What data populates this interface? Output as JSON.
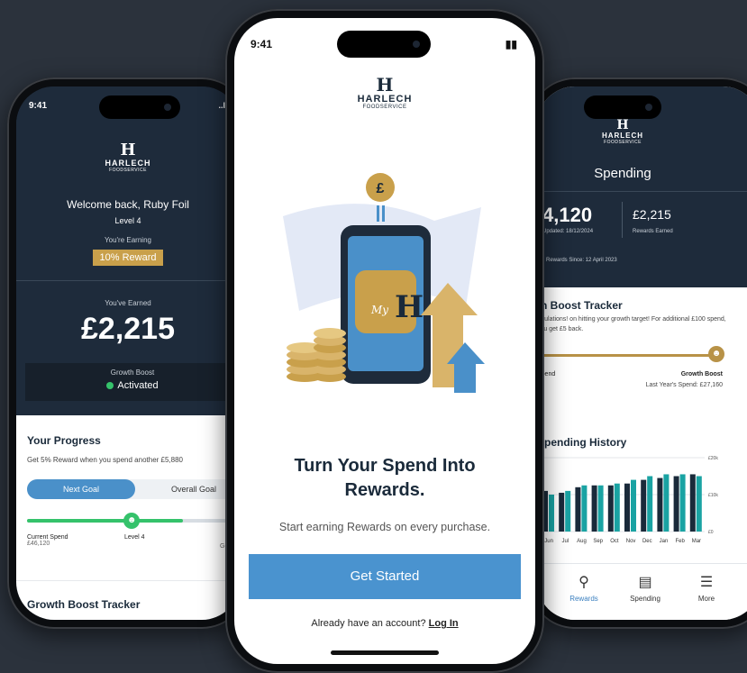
{
  "brand": {
    "initial": "H",
    "name": "HARLECH",
    "tagline": "FOODSERVICE"
  },
  "left_phone": {
    "time": "9:41",
    "signal": "..l",
    "welcome": "Welcome back, Ruby Foil",
    "level": "Level 4",
    "earning_label": "You're Earning",
    "reward_badge": "10% Reward",
    "earned_label": "You've Earned",
    "earned_amount": "£2,215",
    "growth_boost_label": "Growth Boost",
    "growth_boost_status": "Activated",
    "progress_title": "Your Progress",
    "progress_desc": "Get 5% Reward when you spend another £5,880",
    "tab_next": "Next Goal",
    "tab_overall": "Overall Goal",
    "progress_fraction": 0.72,
    "current_spend_label": "Current Spend",
    "current_spend_value": "£46,120",
    "level_marker": "Level 4",
    "goal_label": "Goa",
    "next_section": "Growth Boost Tracker"
  },
  "center_phone": {
    "time": "9:41",
    "headline": "Turn Your Spend Into Rewards.",
    "subtext": "Start earning Rewards on every purchase.",
    "cta": "Get Started",
    "login_prompt": "Already have an account?",
    "login_link": "Log In",
    "illustration_coin": "£",
    "illustration_app_text": "My",
    "illustration_app_mark": "H"
  },
  "right_phone": {
    "page_title": "Spending",
    "spend_value": "4,120",
    "spend_sub": "Updated: 18/12/2024",
    "rewards_value": "£2,215",
    "rewards_sub": "Rewards Earned",
    "since_text": "Rewards Since: 12 April 2023",
    "tracker_title": "th Boost Tracker",
    "tracker_desc": "ratulations! on hitting your growth target! For additional £100 spend, you get £5 back.",
    "spend_label": "Spend",
    "growth_boost_label": "Growth Boost",
    "last_year": "Last Year's Spend: £27,160",
    "history_title": "Spending History",
    "tabs": [
      {
        "label": "Rewards",
        "icon": "trophy-icon"
      },
      {
        "label": "Spending",
        "icon": "card-icon"
      },
      {
        "label": "More",
        "icon": "menu-icon"
      }
    ]
  },
  "chart_data": {
    "type": "bar",
    "categories": [
      "Jun",
      "Jul",
      "Aug",
      "Sep",
      "Oct",
      "Nov",
      "Dec",
      "Jan",
      "Feb",
      "Mar"
    ],
    "series": [
      {
        "values": [
          11,
          10.5,
          12,
          12.5,
          12.5,
          13,
          14,
          14.5,
          15,
          15.5
        ]
      },
      {
        "values": [
          10,
          11,
          12.5,
          12.5,
          13,
          14,
          15,
          15.5,
          15.5,
          15
        ]
      }
    ],
    "y_tick_labels": [
      "£20k",
      "£10k",
      "£0"
    ],
    "ylim": [
      0,
      20
    ],
    "colors": [
      "#1a2a3a",
      "#1aa3a3"
    ]
  }
}
